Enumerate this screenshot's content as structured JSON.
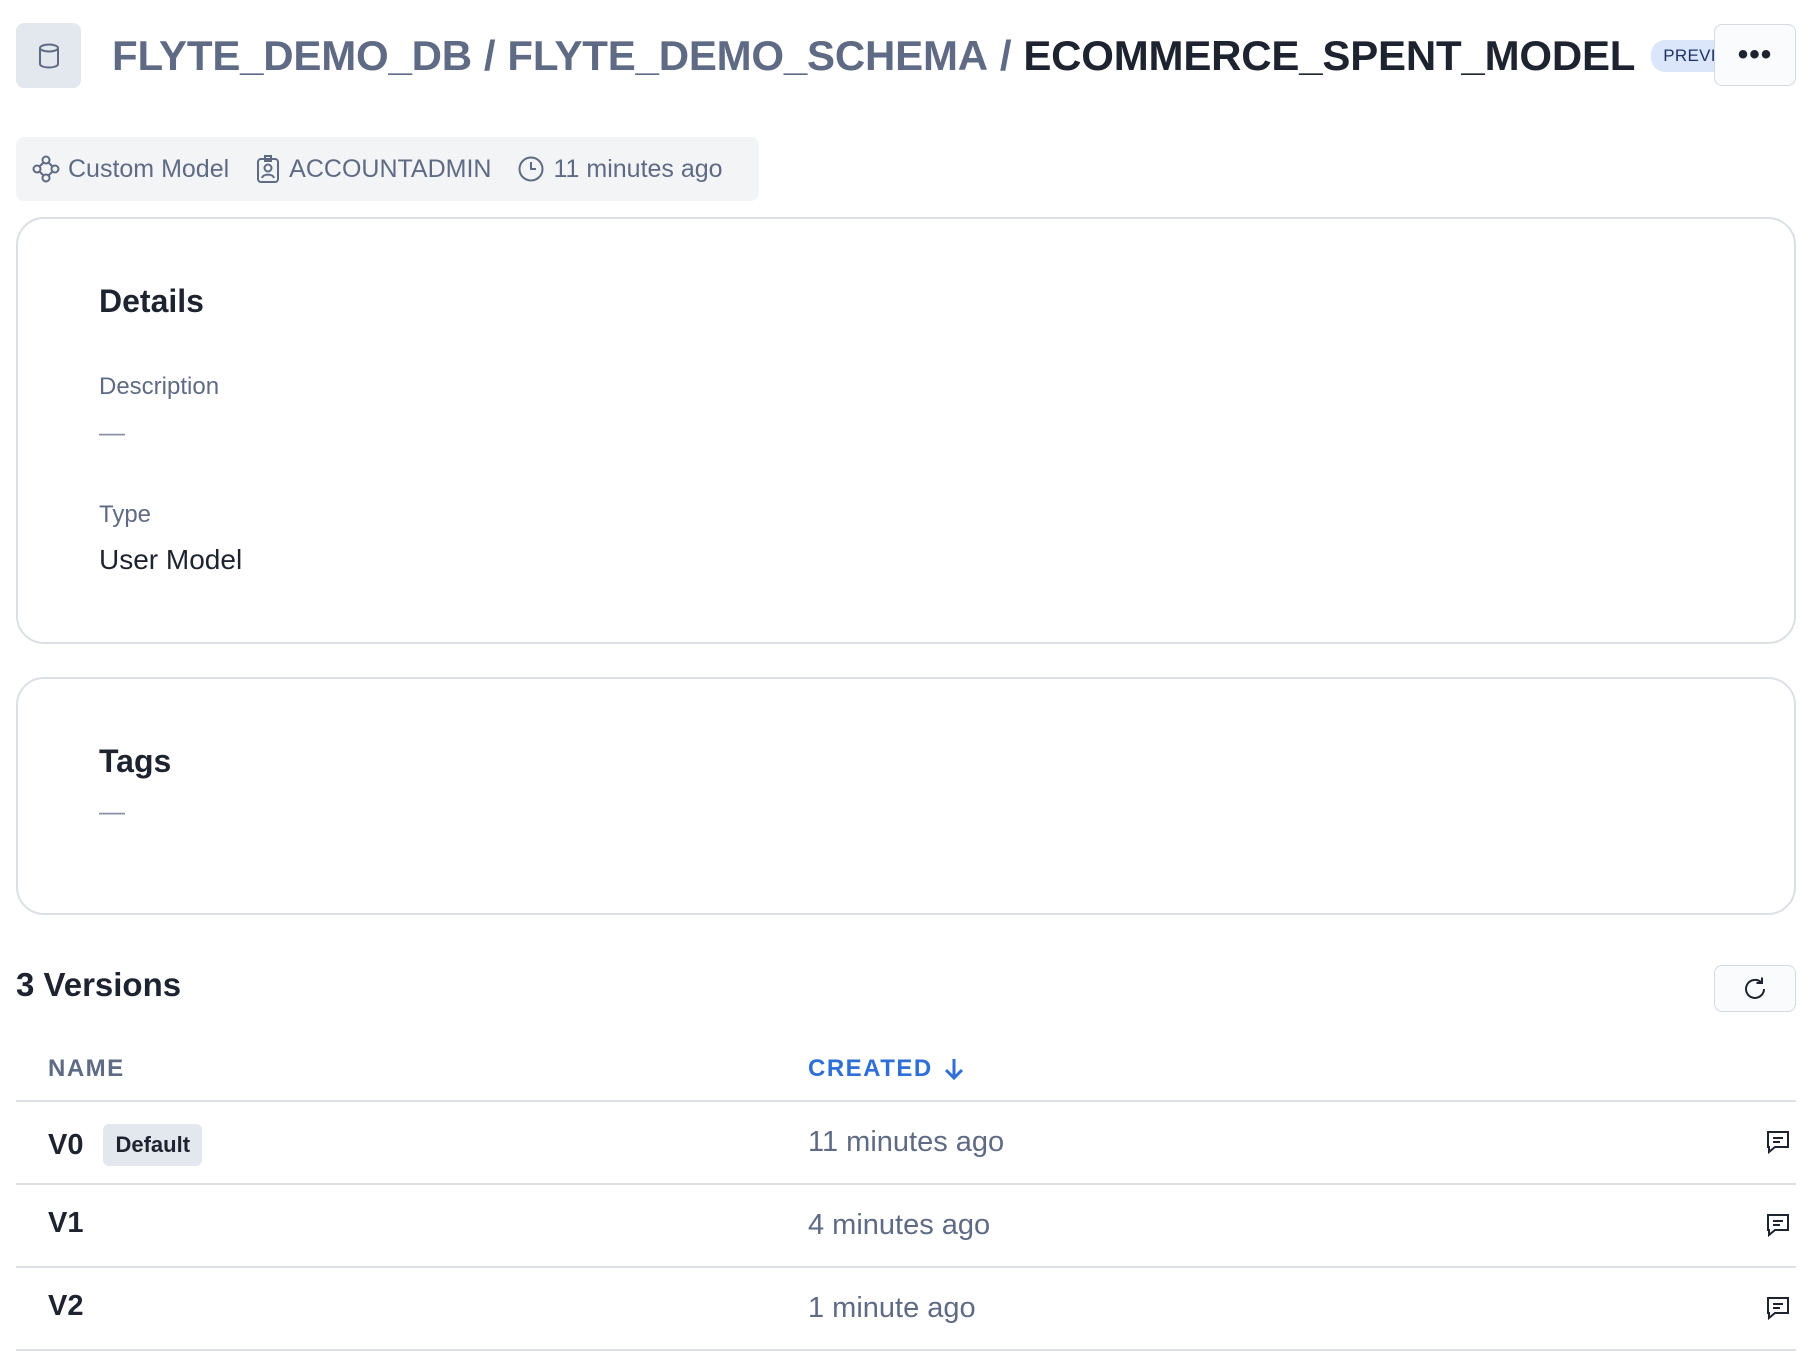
{
  "header": {
    "breadcrumb": {
      "database": "FLYTE_DEMO_DB",
      "separator_1": "/",
      "schema": "FLYTE_DEMO_SCHEMA",
      "separator_2": "/",
      "model": "ECOMMERCE_SPENT_MODEL"
    },
    "badge": "PREVIEW",
    "more_label": "•••",
    "icons": {
      "object": "database-icon",
      "more": "more-options-icon"
    }
  },
  "meta": {
    "type": {
      "icon": "model-graph-icon",
      "label": "Custom Model"
    },
    "owner": {
      "icon": "owner-badge-icon",
      "label": "ACCOUNTADMIN"
    },
    "updated": {
      "icon": "clock-icon",
      "label": "11 minutes ago"
    }
  },
  "details": {
    "title": "Details",
    "description_label": "Description",
    "description_value": "—",
    "type_label": "Type",
    "type_value": "User Model"
  },
  "tags": {
    "title": "Tags",
    "value": "—"
  },
  "versions": {
    "title": "3 Versions",
    "refresh_icon": "refresh-icon",
    "columns": {
      "name": "NAME",
      "created": "CREATED"
    },
    "sort": {
      "column": "created",
      "direction": "descending",
      "icon": "arrow-down-icon"
    },
    "rows": [
      {
        "name": "V0",
        "badge": "Default",
        "created": "11 minutes ago",
        "action_icon": "comment-icon"
      },
      {
        "name": "V1",
        "badge": "",
        "created": "4 minutes ago",
        "action_icon": "comment-icon"
      },
      {
        "name": "V2",
        "badge": "",
        "created": "1 minute ago",
        "action_icon": "comment-icon"
      }
    ]
  },
  "colors": {
    "accent": "#2f6fd6",
    "text_primary": "#1e2330",
    "text_secondary": "#5f6a84",
    "badge_preview_bg": "#dbe6fb",
    "border": "#dcdfe5"
  }
}
